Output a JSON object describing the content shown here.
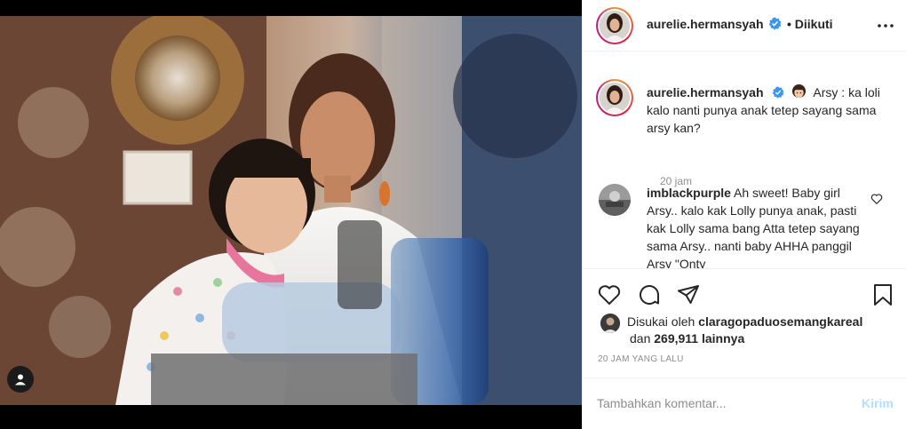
{
  "post": {
    "username": "aurelie.hermansyah",
    "follow_state": "• Diikuti"
  },
  "caption": {
    "username": "aurelie.hermansyah",
    "text": "Arsy : ka loli kalo nanti punya anak tetep sayang sama arsy kan?",
    "time": "20 jam"
  },
  "comments": [
    {
      "username": "imblackpurple",
      "text": "Ah sweet! Baby girl Arsy.. kalo kak Lolly punya anak, pasti kak Lolly sama bang Atta tetep sayang sama Arsy.. nanti baby AHHA panggil Arsy \"Onty"
    }
  ],
  "likes": {
    "prefix": "Disukai oleh",
    "user": "claragopaduosemangkareal",
    "and": "dan",
    "count": "269,911",
    "suffix": "lainnya"
  },
  "timestamp": "20 JAM YANG LALU",
  "add_comment": {
    "placeholder": "Tambahkan komentar...",
    "post_label": "Kirim"
  },
  "icons": {
    "verified": "verified-badge-icon",
    "more": "more-options-icon",
    "like": "heart-icon",
    "comment": "comment-bubble-icon",
    "share": "paper-plane-icon",
    "save": "bookmark-icon",
    "tag": "user-tag-icon"
  },
  "colors": {
    "verified_blue": "#3897f0",
    "post_button_disabled": "#b2dffc",
    "muted_text": "#8e8e8e",
    "divider": "#efefef"
  }
}
